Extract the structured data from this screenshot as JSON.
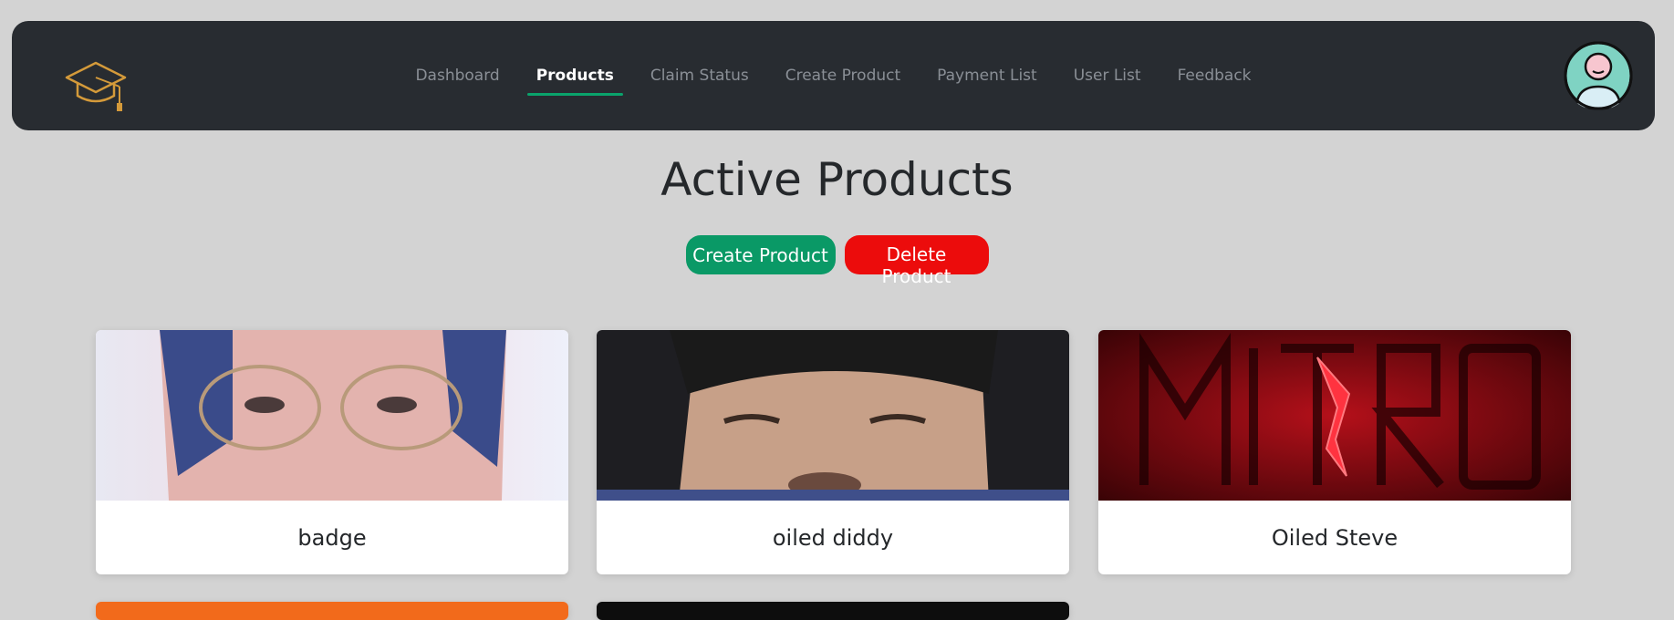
{
  "nav": {
    "logo_icon": "graduation-cap-icon",
    "links": [
      {
        "label": "Dashboard",
        "active": false
      },
      {
        "label": "Products",
        "active": true
      },
      {
        "label": "Claim Status",
        "active": false
      },
      {
        "label": "Create Product",
        "active": false
      },
      {
        "label": "Payment List",
        "active": false
      },
      {
        "label": "User List",
        "active": false
      },
      {
        "label": "Feedback",
        "active": false
      }
    ],
    "avatar_icon": "user-avatar-icon"
  },
  "page": {
    "title": "Active Products",
    "create_button": "Create Product",
    "delete_button": "Delete Product"
  },
  "products": [
    {
      "name": "badge"
    },
    {
      "name": "oiled diddy"
    },
    {
      "name": "Oiled Steve"
    }
  ],
  "colors": {
    "navbar_bg": "#282c31",
    "page_bg": "#d3d3d3",
    "accent_green": "#0aa36b",
    "create_button": "#0a9966",
    "delete_button": "#ec0c0c",
    "logo_gold": "#d49a3a"
  }
}
